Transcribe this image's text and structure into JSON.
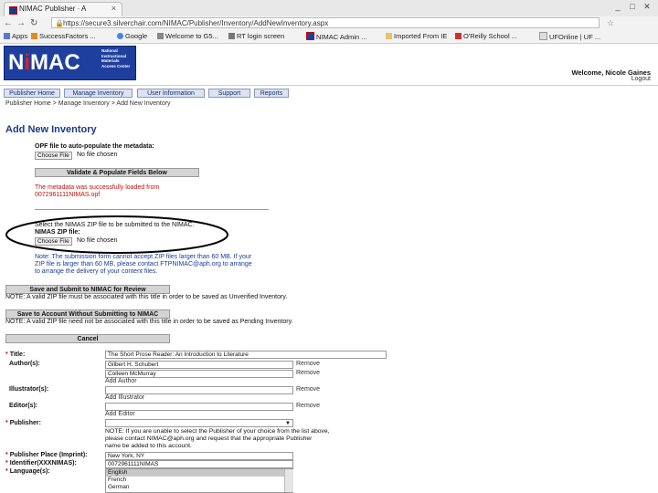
{
  "browser": {
    "tab_title": "NIMAC Publisher · A",
    "tab_close": "×",
    "window_controls": [
      "_",
      "□",
      "✕"
    ],
    "url": "https://secure3.silverchair.com/NIMAC/Publisher/Inventory/AddNewInventory.aspx",
    "bookmarks": [
      "Apps",
      "SuccessFactors ...",
      "Google",
      "Welcome to G5...",
      "RT login screen",
      "NIMAC Admin ...",
      "Imported From IE",
      "O'Reilly School ...",
      "UFOnline | UF ..."
    ]
  },
  "header": {
    "logo_text": "NiMAC",
    "logo_sub": "National Instructional Materials Access Center",
    "welcome": "Welcome, Nicole Gaines",
    "logout": "Logout"
  },
  "nav": {
    "items": [
      "Publisher Home",
      "Manage Inventory",
      "User Information",
      "Support",
      "Reports"
    ],
    "breadcrumb": "Publisher Home > Manage Inventory > Add New Inventory"
  },
  "page": {
    "title": "Add New Inventory",
    "opf_label": "OPF file to auto-populate the metadata:",
    "choose_file": "Choose File",
    "no_file": "No file chosen",
    "validate_button": "Validate & Populate Fields Below",
    "success_msg": "The metadata was successfully loaded from",
    "success_file": "0072961111NIMAS.opf",
    "zip_instruction": "Select the NIMAS ZIP file to be submitted to the NIMAC.",
    "zip_label": "NIMAS ZIP file:",
    "note_lines": [
      "Note: The submission form cannot accept ZIP files larger than 60 MB. If your",
      "ZIP file is larger than 60 MB, please contact FTPNIMAC@aph.org to arrange",
      "to arrange the delivery of your content files."
    ],
    "submit_button": "Save and Submit to NIMAC for Review",
    "submit_note": "NOTE: A valid ZIP file must be associated with this title in order to be saved as Unverified Inventory.",
    "save_button": "Save to Account Without Submitting to NIMAC",
    "save_note": "NOTE: A valid ZIP file need not be associated with this title in order to be saved as Pending Inventory.",
    "cancel_button": "Cancel"
  },
  "form": {
    "title_label": "Title:",
    "title_value": "The Short Prose Reader: An Introduction to Literature",
    "authors_label": "Author(s):",
    "authors": [
      "Gilbert H. Schubert",
      "Colleen McMurray"
    ],
    "remove": "Remove",
    "add_author": "Add Author",
    "illustrators_label": "Illustrator(s):",
    "add_illustrator": "Add Illustrator",
    "editors_label": "Editor(s):",
    "add_editor": "Add Editor",
    "publisher_label": "Publisher:",
    "publisher_note_lines": [
      "NOTE: If you are unable to select the Publisher of your choice from the list above,",
      "please contact NIMAC@aph.org and request that the appropriate Publisher",
      "name be added to this account."
    ],
    "place_label": "Publisher Place (Imprint):",
    "place_value": "New York, NY",
    "identifier_label": "Identifier(XXXNIMAS):",
    "identifier_value": "0072961111NIMAS",
    "language_label": "Language(s):",
    "languages": [
      "English",
      "French",
      "German"
    ],
    "required_mark": "*"
  },
  "colors": {
    "brand_blue": "#1f3f9e",
    "brand_red": "#e02020",
    "error_red": "#c01010"
  }
}
